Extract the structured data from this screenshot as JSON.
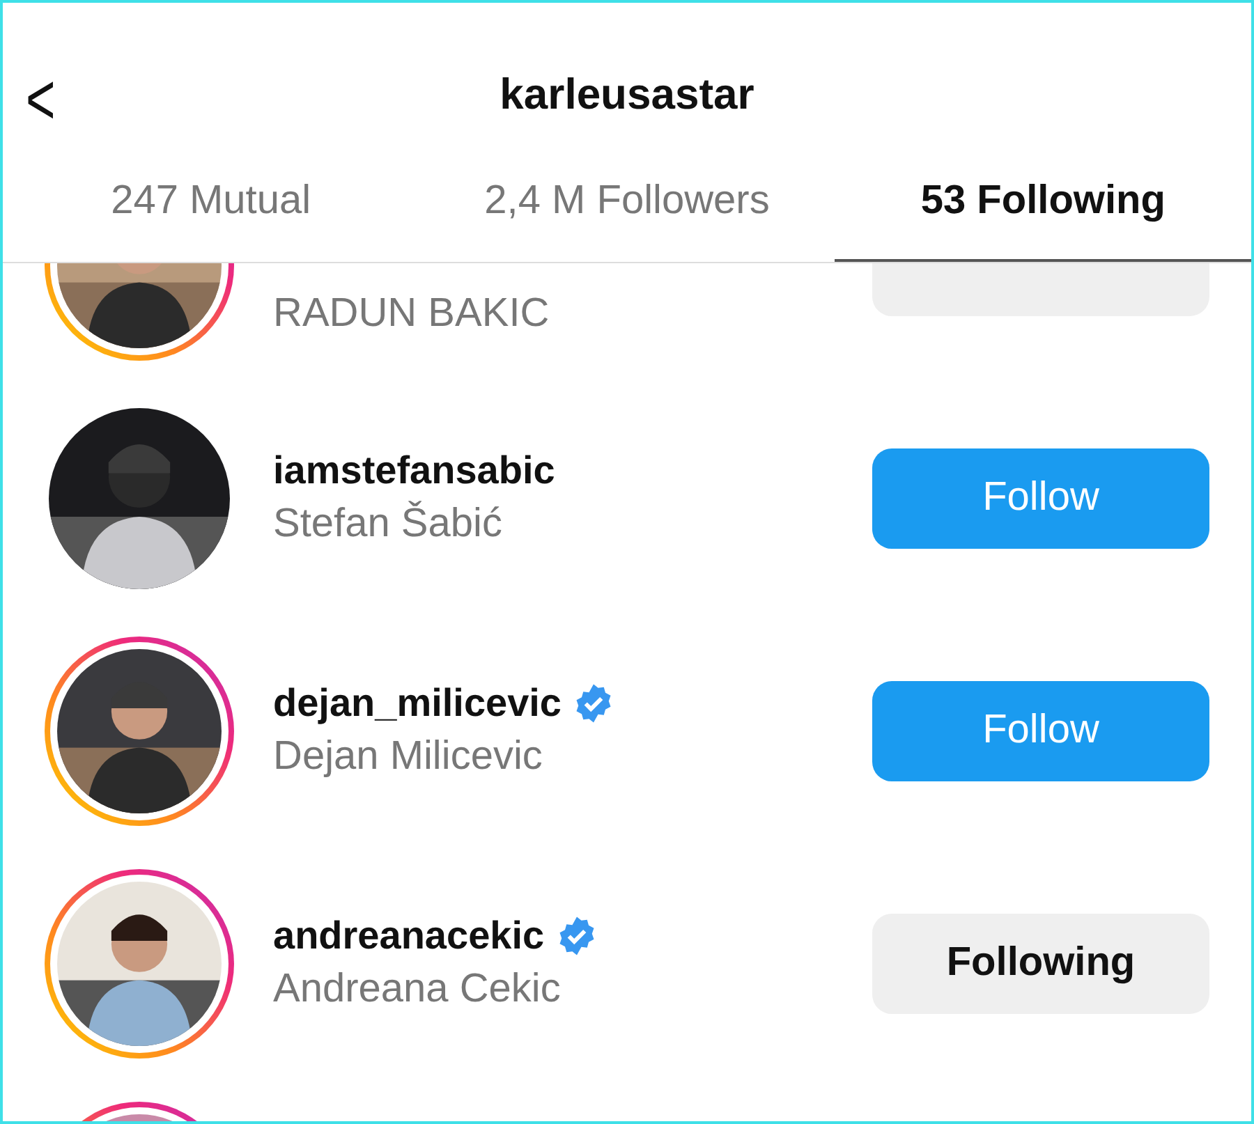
{
  "header": {
    "back": "<",
    "title": "karleusastar"
  },
  "tabs": [
    {
      "label": "247 Mutual",
      "selected": false
    },
    {
      "label": "2,4 M Followers",
      "selected": false
    },
    {
      "label": "53 Following",
      "selected": true
    }
  ],
  "rows": [
    {
      "name": "RADUN BAKIC",
      "story": true,
      "verified": false,
      "button": {
        "kind": "following"
      }
    },
    {
      "username": "iamstefansabic",
      "name": "Stefan Šabić",
      "story": false,
      "verified": false,
      "button": {
        "kind": "follow",
        "label": "Follow"
      }
    },
    {
      "username": "dejan_milicevic",
      "name": "Dejan Milicevic",
      "story": true,
      "verified": true,
      "button": {
        "kind": "follow",
        "label": "Follow"
      }
    },
    {
      "username": "andreanacekic",
      "name": "Andreana Cekic",
      "story": true,
      "verified": true,
      "button": {
        "kind": "following",
        "label": "Following"
      }
    },
    {
      "story": true,
      "verified": false
    }
  ]
}
